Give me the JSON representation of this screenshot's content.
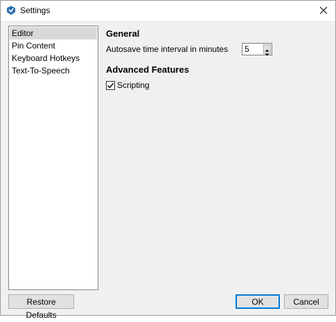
{
  "window": {
    "title": "Settings",
    "accent_color": "#0078d7"
  },
  "sidebar": {
    "selected_index": 0,
    "items": [
      {
        "label": "Editor"
      },
      {
        "label": "Pin Content"
      },
      {
        "label": "Keyboard Hotkeys"
      },
      {
        "label": "Text-To-Speech"
      }
    ]
  },
  "main": {
    "general": {
      "heading": "General",
      "autosave_label": "Autosave time interval in minutes",
      "autosave_value": "5"
    },
    "advanced": {
      "heading": "Advanced Features",
      "scripting_label": "Scripting",
      "scripting_checked": true
    }
  },
  "footer": {
    "restore_label": "Restore Defaults",
    "ok_label": "OK",
    "cancel_label": "Cancel"
  },
  "icons": {
    "app": "app-logo-icon",
    "close": "close-icon",
    "check": "check-icon",
    "spin_up": "arrow-up-icon",
    "spin_down": "arrow-down-icon"
  }
}
